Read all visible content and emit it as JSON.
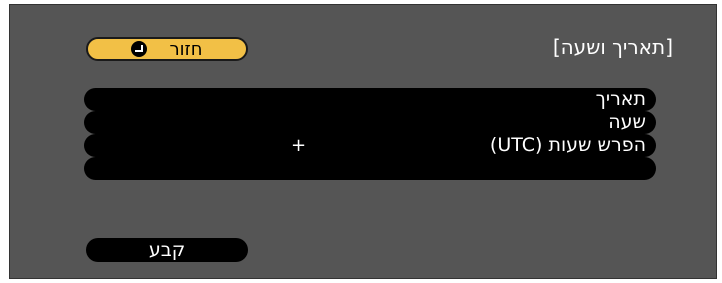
{
  "header": {
    "title": "[תאריך ושעה]",
    "back_label": "חזור",
    "back_icon": "enter-icon"
  },
  "rows": [
    {
      "label": "תאריך",
      "value": ""
    },
    {
      "label": "שעה",
      "value": ""
    },
    {
      "label": "הפרש שעות (UTC)",
      "value": "+"
    },
    {
      "label": "",
      "value": ""
    }
  ],
  "footer": {
    "set_label": "קבע"
  },
  "colors": {
    "panel": "#555555",
    "accent": "#f2c046",
    "row": "#000000",
    "text": "#ffffff"
  }
}
